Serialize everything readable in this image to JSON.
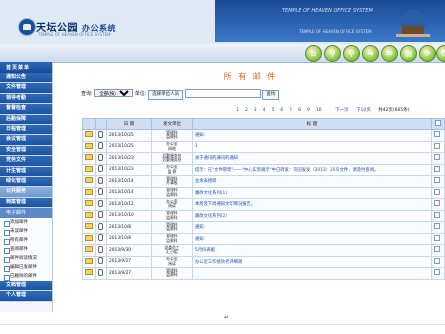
{
  "header": {
    "logo_text": "天坛公园",
    "logo_suffix": "办公系统",
    "logo_sub": "TEMPLE OF HEAVEN OFFICE SYSTEM",
    "banner_title": "TEMPLE OF HEAVEN OFFICE SYSTEM",
    "banner_subtitle": "TEMPLE OF HEAVEN OFFICE SYSTEM"
  },
  "nav_buttons": [
    {
      "icon": "home-icon",
      "glyph": "⌂"
    },
    {
      "icon": "search-icon",
      "glyph": "⚲"
    },
    {
      "icon": "search-icon",
      "glyph": "⚲"
    },
    {
      "icon": "arrow-right-icon",
      "glyph": "➜"
    },
    {
      "icon": "mail-icon",
      "glyph": "✉"
    },
    {
      "icon": "document-icon",
      "glyph": "▤"
    },
    {
      "icon": "refresh-icon",
      "glyph": "⟳"
    },
    {
      "icon": "power-icon",
      "glyph": "⏻"
    }
  ],
  "sidebar": {
    "head": "首页菜单",
    "items": [
      "通知公告",
      "文件管理",
      "领导考勤",
      "督督检查",
      "后勤保障",
      "日程管理",
      "会议管理",
      "安全管理",
      "党务文件",
      "计生管理",
      "绿化管理"
    ],
    "section": "公共服务",
    "archive": "档案管理",
    "email_header": "电子邮件",
    "email_items": [
      "添加邮件",
      "未读邮件",
      "所有邮件",
      "查阅邮件",
      "邮件阅读情况",
      "编辑已发邮件",
      "已删除的邮件"
    ],
    "extra": [
      "文档管理",
      "个人管理"
    ]
  },
  "main": {
    "title": "所 有 邮 件",
    "filter_label": "查询:",
    "filter_select": "全部(按)",
    "filter_unit_label": "单位:",
    "filter_unit_button": "选择单位人员",
    "filter_input": "",
    "filter_search": "查找"
  },
  "pager": {
    "pages": [
      "1",
      "2",
      "3",
      "4",
      "5",
      "6",
      "7",
      "8",
      "9",
      "10"
    ],
    "next": "下一页",
    "next10": "下10页",
    "total": "共42页(665条)"
  },
  "table": {
    "headers": [
      "",
      "",
      "日 期",
      "发文单位",
      "标  题",
      ""
    ],
    "rows": [
      {
        "date": "2013/10/25",
        "sender": "管理科\n监察科",
        "subject": "通知:"
      },
      {
        "date": "2013/10/25",
        "sender": "办公室\n网络",
        "subject": "1"
      },
      {
        "date": "2013/10/23",
        "sender": "后勤服务处\n后勤服务处",
        "subject": "关于通讯的通讯的通知"
      },
      {
        "date": "2013/10/23",
        "sender": "办公室\n监 察",
        "subject": "提示：在\"文件管理\"——\"中心实际展示\"中已转发：京园发发（2013）35号文件，请及时查阅。"
      },
      {
        "date": "2013/10/14",
        "sender": "管理科\n外事股",
        "subject": "业余表授转"
      },
      {
        "date": "2013/10/14",
        "sender": "管理科\n监察科",
        "subject": "廉政文化系列(1)"
      },
      {
        "date": "2013/10/12",
        "sender": "办公室\n阅读",
        "subject": "本周及下周通知文印情况报告。"
      },
      {
        "date": "2013/10/10",
        "sender": "管理科\n监察科",
        "subject": "廉政文化系列(2)"
      },
      {
        "date": "2013/10/8",
        "sender": "管理科\n监察科",
        "subject": "通知:"
      },
      {
        "date": "2013/10/8",
        "sender": "管理科\n监察科",
        "subject": "通知:"
      },
      {
        "date": "2013/9/30",
        "sender": "党委员工\n汇小组",
        "subject": "5月份表据"
      },
      {
        "date": "2013/9/27",
        "sender": "办公室\n阅读",
        "subject": "办公室工作绩效考评细则"
      },
      {
        "date": "2013/9/27",
        "sender": "管理科\n监察科",
        "subject": ""
      }
    ]
  },
  "footer": {
    "mark": "↵"
  }
}
